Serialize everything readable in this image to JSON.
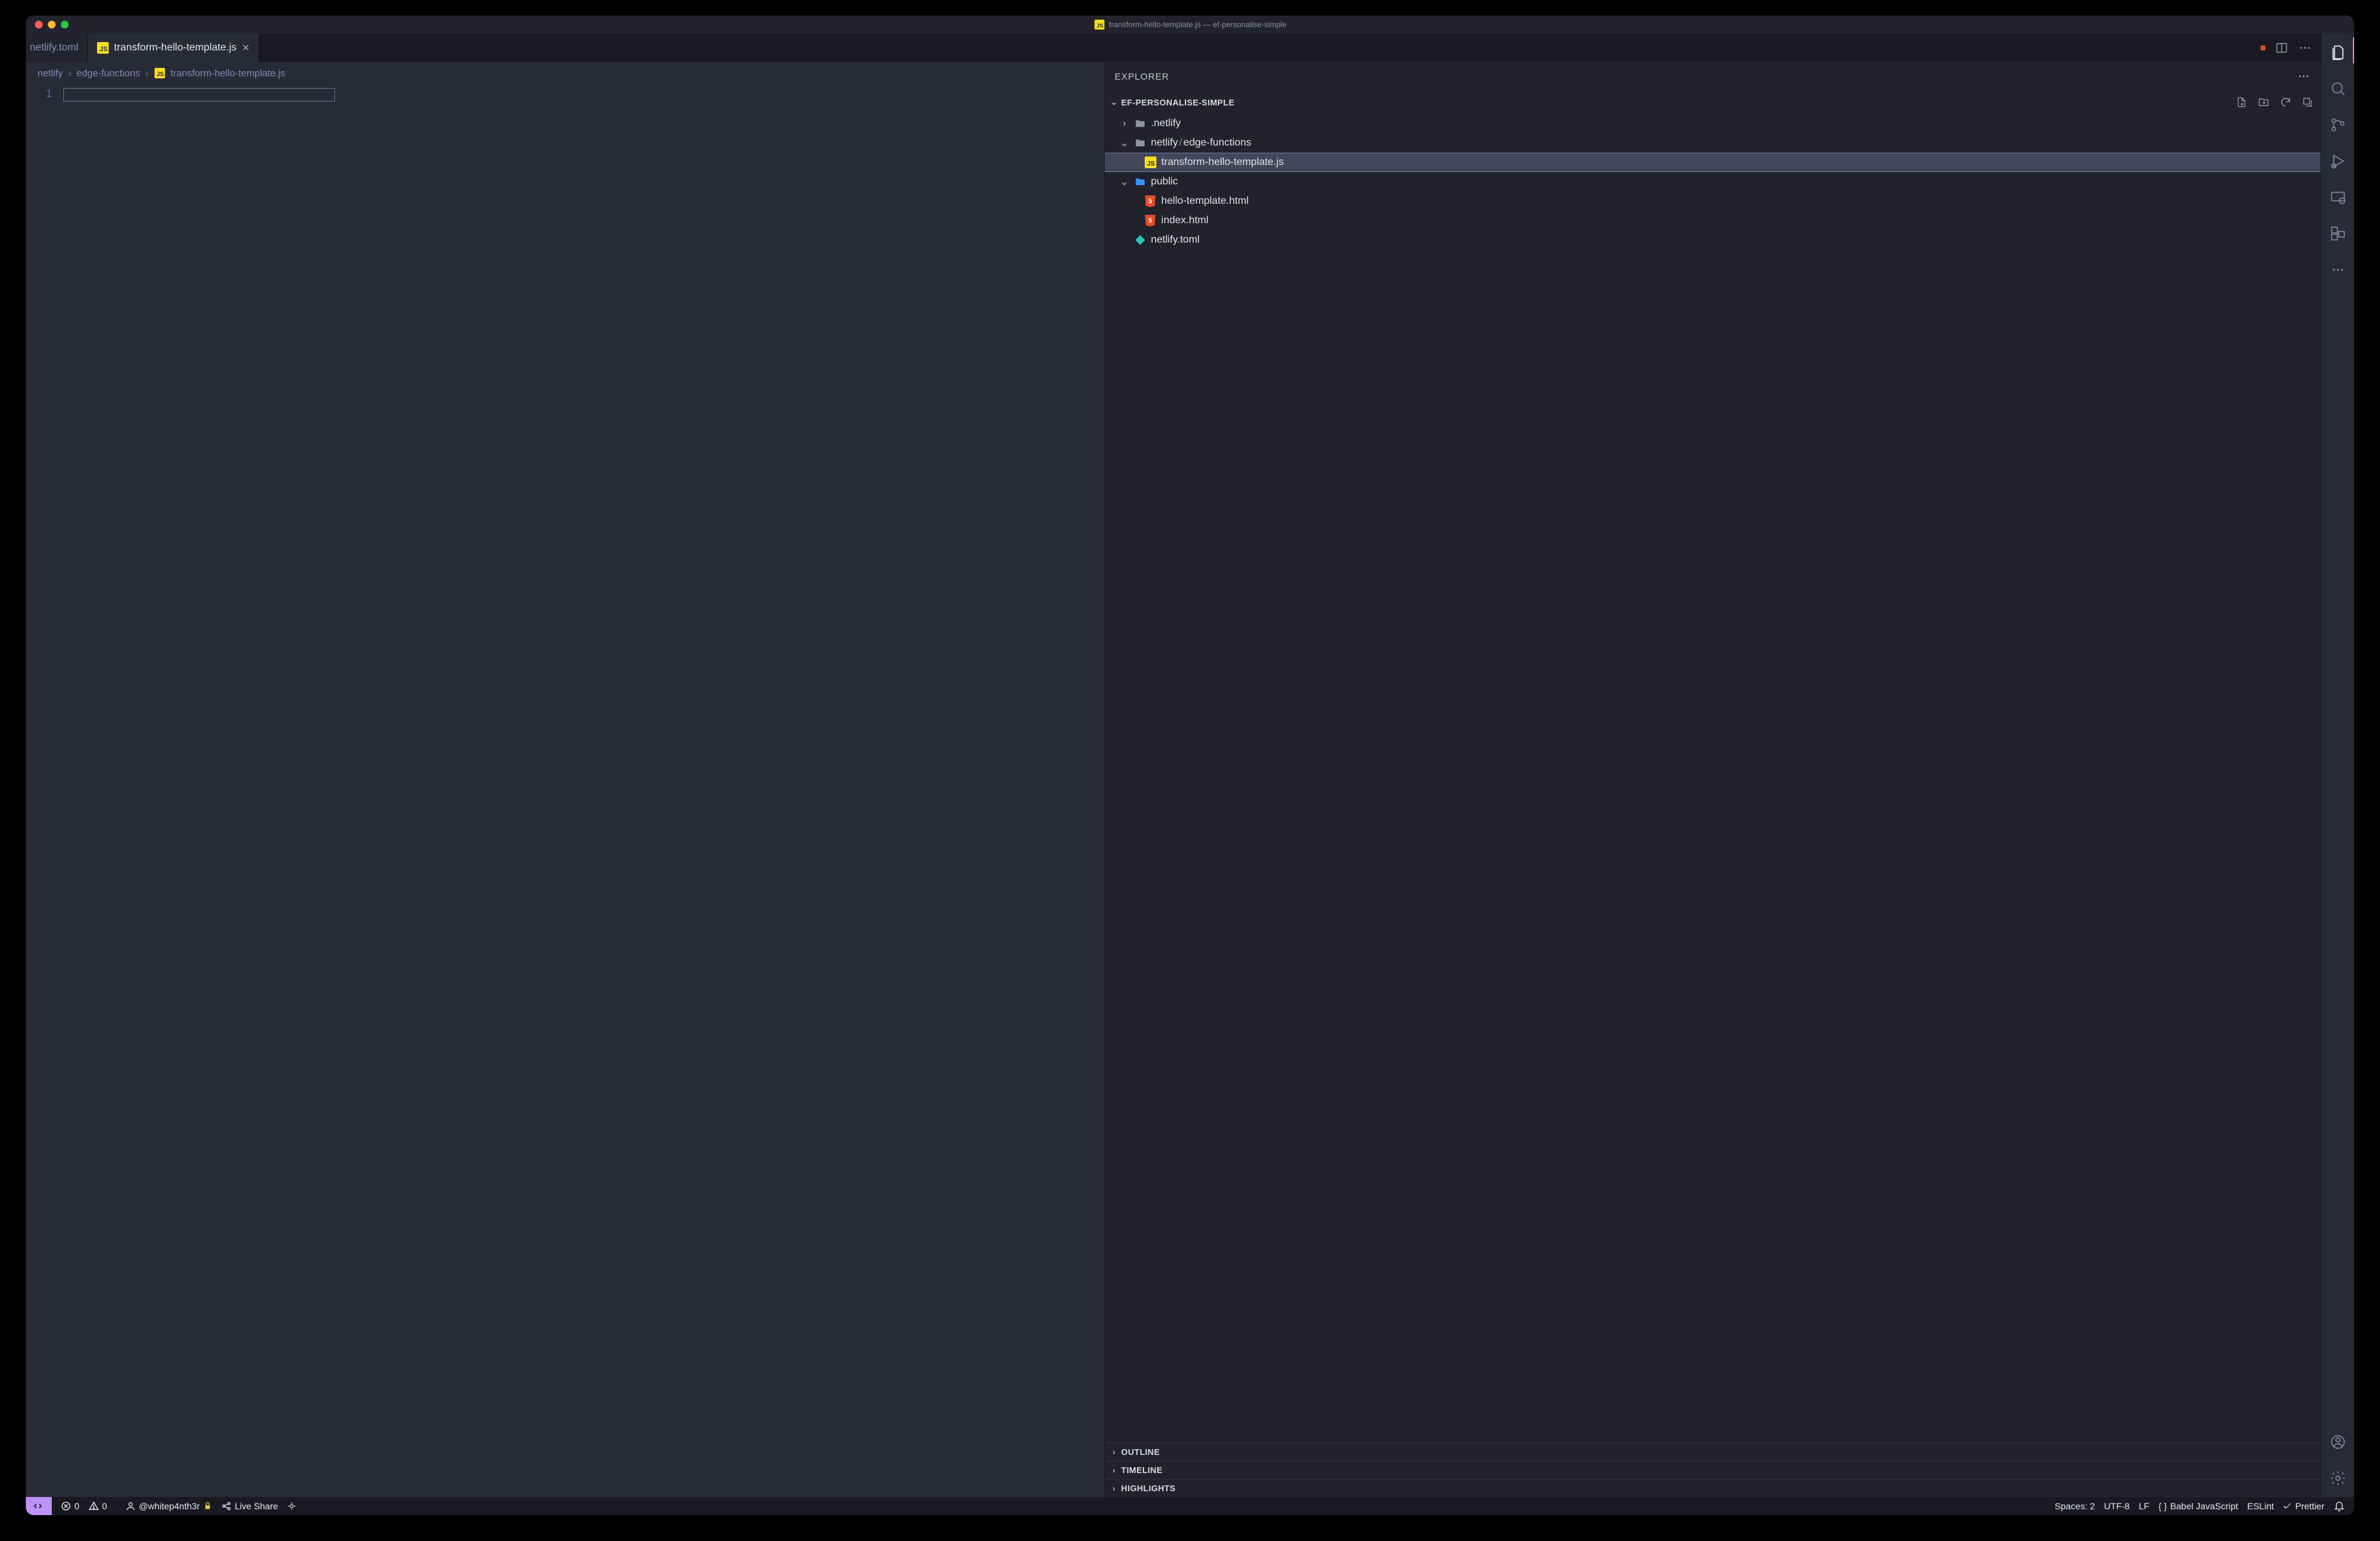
{
  "titlebar": {
    "title": "transform-hello-template.js — ef-personalise-simple"
  },
  "tabs": {
    "partial_inactive": "netlify.toml",
    "active_file": "transform-hello-template.js"
  },
  "breadcrumb": {
    "p1": "netlify",
    "p2": "edge-functions",
    "p3": "transform-hello-template.js"
  },
  "editor": {
    "line_number_1": "1"
  },
  "explorer": {
    "title": "EXPLORER",
    "project": "EF-PERSONALISE-SIMPLE",
    "tree": {
      "netlify_folder": ".netlify",
      "netlify_path_a": "netlify",
      "netlify_path_b": "edge-functions",
      "transform_file": "transform-hello-template.js",
      "public_folder": "public",
      "hello_template": "hello-template.html",
      "index_html": "index.html",
      "netlify_toml": "netlify.toml"
    },
    "outline": "OUTLINE",
    "timeline": "TIMELINE",
    "highlights": "HIGHLIGHTS"
  },
  "status": {
    "errors": "0",
    "warnings": "0",
    "user": "@whitep4nth3r",
    "live_share": "Live Share",
    "spaces": "Spaces: 2",
    "encoding": "UTF-8",
    "eol": "LF",
    "language": "Babel JavaScript",
    "eslint": "ESLint",
    "prettier": "Prettier"
  }
}
